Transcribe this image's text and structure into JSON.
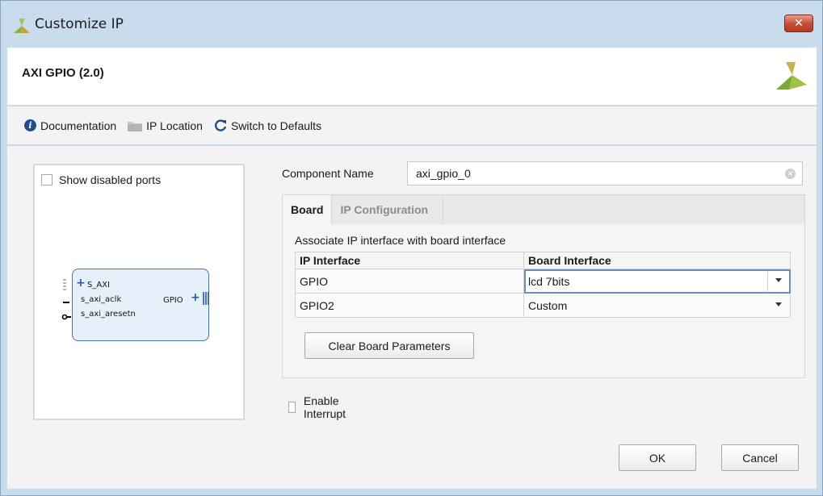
{
  "window": {
    "title": "Customize IP",
    "close_glyph": "✕"
  },
  "header": {
    "ip_title": "AXI GPIO (2.0)"
  },
  "toolbar": {
    "documentation": "Documentation",
    "ip_location": "IP Location",
    "switch_defaults": "Switch to Defaults"
  },
  "left_panel": {
    "show_disabled_ports": "Show disabled ports",
    "show_disabled_ports_checked": false,
    "block": {
      "ports_left": [
        "S_AXI",
        "s_axi_aclk",
        "s_axi_aresetn"
      ],
      "ports_right": [
        "GPIO"
      ]
    }
  },
  "component": {
    "label": "Component Name",
    "value": "axi_gpio_0"
  },
  "tabs": [
    {
      "label": "Board",
      "active": true
    },
    {
      "label": "IP Configuration",
      "active": false
    }
  ],
  "board": {
    "heading": "Associate IP interface with board interface",
    "columns": [
      "IP Interface",
      "Board Interface"
    ],
    "rows": [
      {
        "ip": "GPIO",
        "board": "lcd 7bits"
      },
      {
        "ip": "GPIO2",
        "board": "Custom"
      }
    ],
    "clear_button": "Clear Board Parameters"
  },
  "enable_interrupt": {
    "label": "Enable Interrupt",
    "checked": false
  },
  "buttons": {
    "ok": "OK",
    "cancel": "Cancel"
  },
  "icons": {
    "app_logo": "xilinx-logo-icon",
    "info": "info-icon",
    "folder": "folder-icon",
    "refresh": "refresh-icon"
  },
  "colors": {
    "accent": "#1f4f8a",
    "logo_green": "#8bb43a",
    "logo_gold": "#c8a43a",
    "close": "#c75039"
  }
}
